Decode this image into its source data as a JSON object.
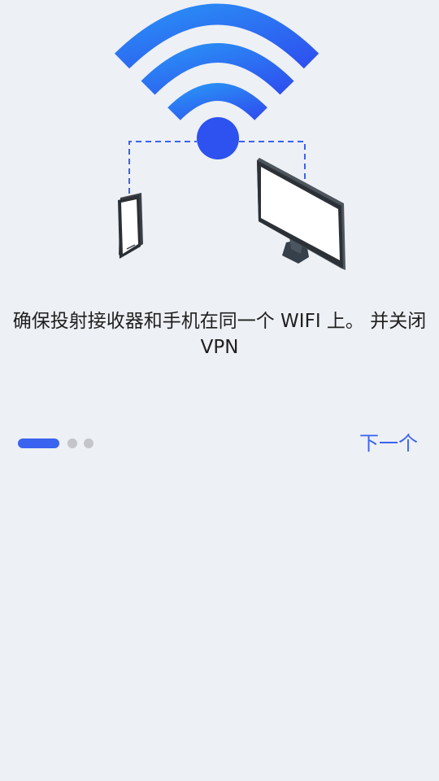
{
  "onboarding": {
    "instruction": "确保投射接收器和手机在同一个 WIFI 上。 并关闭 VPN",
    "next_label": "下一个",
    "page_indicator": {
      "total": 3,
      "current": 1
    }
  },
  "illustration": {
    "icons": [
      "wifi-icon",
      "phone-icon",
      "monitor-icon"
    ]
  },
  "colors": {
    "background": "#edf0f4",
    "accent": "#3a63f0",
    "inactive_dot": "#c3c5c9",
    "text": "#1f1f1f"
  }
}
